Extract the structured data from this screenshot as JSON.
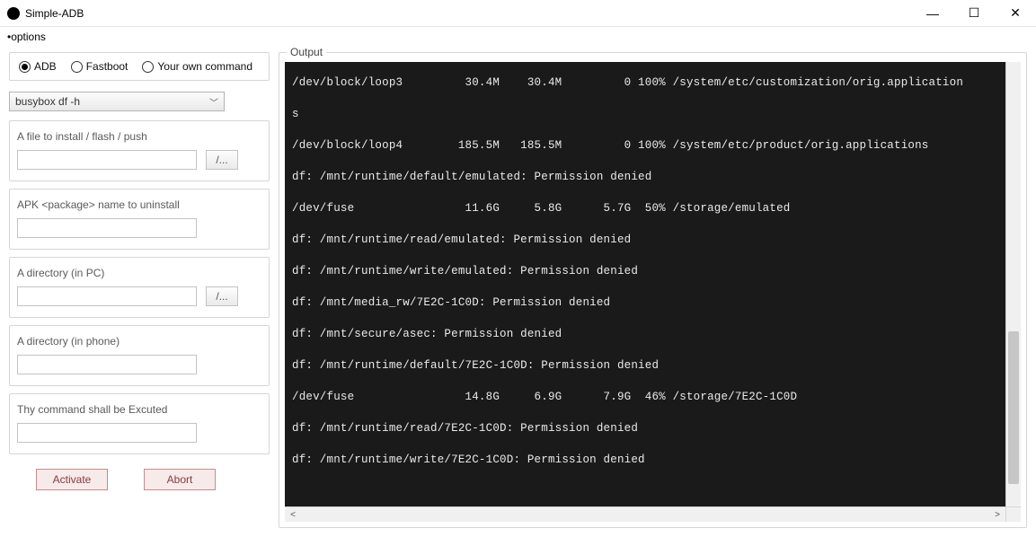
{
  "window": {
    "title": "Simple-ADB"
  },
  "menu": {
    "options": "•options"
  },
  "mode": {
    "adb": "ADB",
    "fastboot": "Fastboot",
    "own": "Your own command",
    "selected": "adb"
  },
  "combo": {
    "value": "busybox df -h"
  },
  "sections": {
    "file": {
      "label": "A file to install / flash / push",
      "browse": "/..."
    },
    "apk": {
      "label": "APK <package> name to uninstall"
    },
    "dir_pc": {
      "label": "A directory (in PC)",
      "browse": "/..."
    },
    "dir_phone": {
      "label": "A directory (in phone)"
    },
    "command": {
      "label": "Thy command shall be Excuted"
    }
  },
  "buttons": {
    "activate": "Activate",
    "abort": "Abort"
  },
  "output": {
    "legend": "Output",
    "lines": [
      "/dev/block/loop3         30.4M    30.4M         0 100% /system/etc/customization/orig.application",
      "s",
      "/dev/block/loop4        185.5M   185.5M         0 100% /system/etc/product/orig.applications",
      "df: /mnt/runtime/default/emulated: Permission denied",
      "/dev/fuse                11.6G     5.8G      5.7G  50% /storage/emulated",
      "df: /mnt/runtime/read/emulated: Permission denied",
      "df: /mnt/runtime/write/emulated: Permission denied",
      "df: /mnt/media_rw/7E2C-1C0D: Permission denied",
      "df: /mnt/secure/asec: Permission denied",
      "df: /mnt/runtime/default/7E2C-1C0D: Permission denied",
      "/dev/fuse                14.8G     6.9G      7.9G  46% /storage/7E2C-1C0D",
      "df: /mnt/runtime/read/7E2C-1C0D: Permission denied",
      "df: /mnt/runtime/write/7E2C-1C0D: Permission denied"
    ]
  }
}
